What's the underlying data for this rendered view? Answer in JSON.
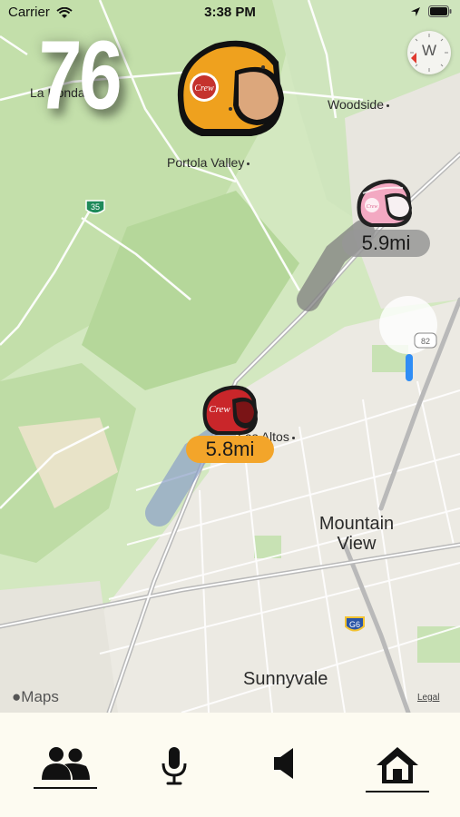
{
  "status_bar": {
    "carrier": "Carrier",
    "time": "3:38 PM"
  },
  "speed": "76",
  "compass": {
    "heading_letter": "W"
  },
  "map": {
    "places": {
      "la_honda": "La Honda",
      "woodside": "Woodside",
      "portola_valley": "Portola Valley",
      "los_altos": "Los Altos",
      "mountain_view_1": "Mountain",
      "mountain_view_2": "View",
      "sunnyvale": "Sunnyvale"
    },
    "shields": {
      "hwy35": "35",
      "hwy82": "82",
      "g6": "G6"
    },
    "attribution": "Maps",
    "legal": "Legal"
  },
  "riders": [
    {
      "helmet": "orange",
      "logo": "Crew",
      "distance": ""
    },
    {
      "helmet": "pink",
      "logo": "Crew",
      "distance": "5.9mi"
    },
    {
      "helmet": "red",
      "logo": "Crew",
      "distance": "5.8mi"
    }
  ],
  "tabs": [
    {
      "icon": "group-icon",
      "active": true
    },
    {
      "icon": "microphone-icon",
      "active": false
    },
    {
      "icon": "speaker-icon",
      "active": false
    },
    {
      "icon": "home-icon",
      "active": true
    }
  ],
  "colors": {
    "map_green": "#c7e3b1",
    "accent_orange": "#f3a52a",
    "badge_gray": "#969696",
    "tabbar_bg": "#fdfbf1"
  }
}
